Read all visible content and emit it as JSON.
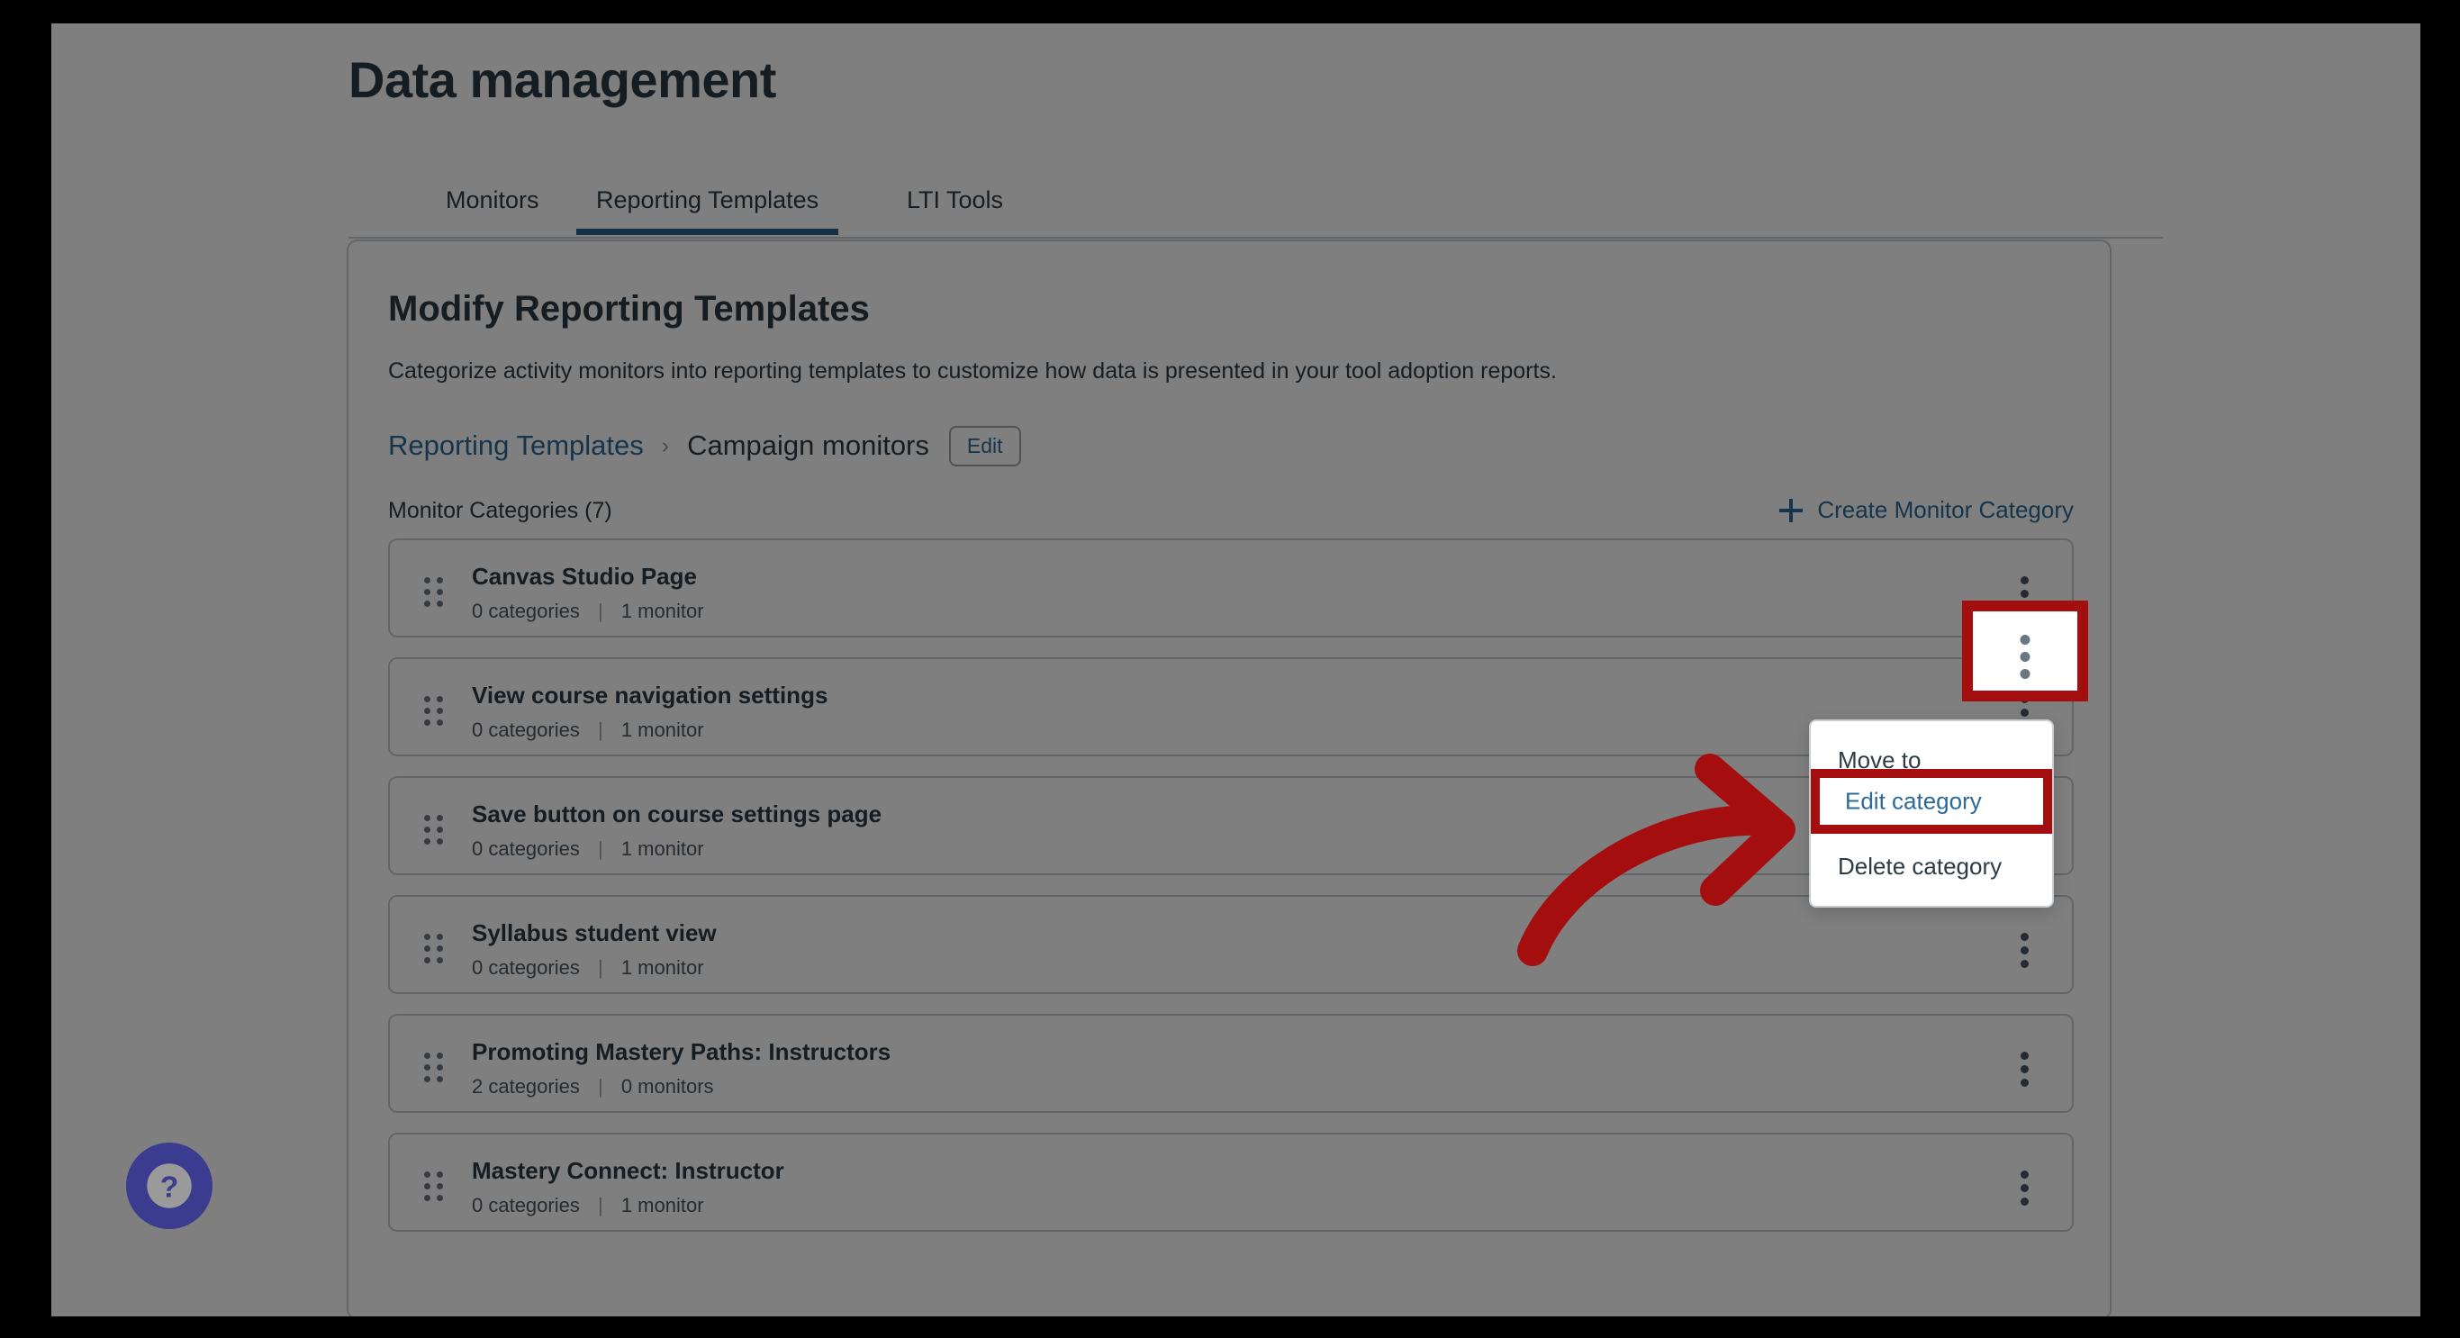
{
  "page": {
    "title": "Data management"
  },
  "tabs": [
    {
      "label": "Monitors",
      "active": false
    },
    {
      "label": "Reporting Templates",
      "active": true
    },
    {
      "label": "LTI Tools",
      "active": false
    }
  ],
  "card": {
    "title": "Modify Reporting Templates",
    "description": "Categorize activity monitors into reporting templates to customize how data is presented in your tool adoption reports."
  },
  "breadcrumb": {
    "parent": "Reporting Templates",
    "separator": "›",
    "current": "Campaign monitors",
    "edit_label": "Edit"
  },
  "categories_header": {
    "count_label": "Monitor Categories (7)",
    "create_label": "Create Monitor Category",
    "create_icon": "plus-icon"
  },
  "categories": [
    {
      "name": "Canvas Studio Page",
      "categories": "0 categories",
      "monitors": "1 monitor",
      "separator": "|"
    },
    {
      "name": "View course navigation settings",
      "categories": "0 categories",
      "monitors": "1 monitor",
      "separator": "|"
    },
    {
      "name": "Save button on course settings page",
      "categories": "0 categories",
      "monitors": "1 monitor",
      "separator": "|"
    },
    {
      "name": "Syllabus student view",
      "categories": "0 categories",
      "monitors": "1 monitor",
      "separator": "|"
    },
    {
      "name": "Promoting Mastery Paths: Instructors",
      "categories": "2 categories",
      "monitors": "0 monitors",
      "separator": "|"
    },
    {
      "name": "Mastery Connect: Instructor",
      "categories": "0 categories",
      "monitors": "1 monitor",
      "separator": "|"
    }
  ],
  "context_menu": {
    "items": [
      {
        "label": "Move to",
        "highlighted": false
      },
      {
        "label": "Edit category",
        "highlighted": true
      },
      {
        "label": "Delete category",
        "highlighted": false
      }
    ]
  },
  "annotations": {
    "highlight_color": "#a50e0e",
    "kebab_callout_icon": "kebab-menu-icon",
    "menu_callout_label": "Edit category",
    "arrow_icon": "curved-arrow-icon"
  },
  "help": {
    "icon": "question-mark-icon",
    "color": "#3b3c8f"
  }
}
